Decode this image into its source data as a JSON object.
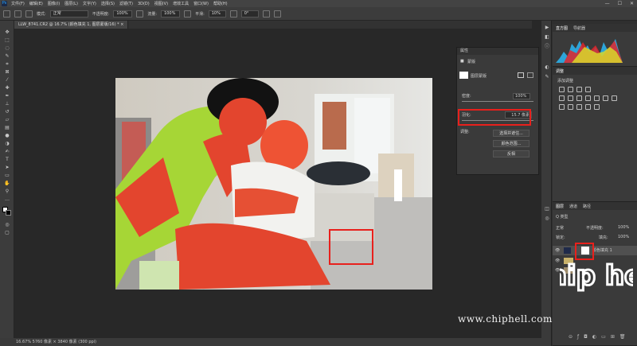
{
  "app_icon": "Ps",
  "menu": [
    "文件(F)",
    "编辑(E)",
    "图像(I)",
    "图层(L)",
    "文字(Y)",
    "选择(S)",
    "滤镜(T)",
    "3D(D)",
    "视图(V)",
    "增效工具",
    "窗口(W)",
    "帮助(H)"
  ],
  "window_controls": [
    "—",
    "☐",
    "✕"
  ],
  "options_bar": {
    "mode_label": "模式:",
    "mode_value": "正常",
    "opacity_label": "不透明度:",
    "opacity_value": "100%",
    "flow_label": "流量:",
    "flow_value": "100%",
    "smooth_label": "平滑:",
    "smooth_value": "10%",
    "angle_value": "0°"
  },
  "document_tab": "LLW_8741.CR2 @ 16.7% (颜色填充 1, 图层蒙版/16) * ×",
  "status_bar": "16.67%    5760 像素 × 3840 像素 (300 ppi)",
  "histogram_panel": {
    "tabs": [
      "直方图",
      "导航器"
    ]
  },
  "properties_panel": {
    "title": "属性",
    "section_label": "蒙版",
    "layer_mask_label": "图层蒙版",
    "density_label": "密度:",
    "density_value": "100%",
    "feather_label": "羽化:",
    "feather_value": "15.7 像素",
    "adjust_label": "调整:",
    "buttons": [
      "选择并遮住...",
      "颜色范围...",
      "反相"
    ]
  },
  "adjustments_panel": {
    "title": "调整",
    "subtitle": "添加调整"
  },
  "layers_panel": {
    "tabs": [
      "图层",
      "通道",
      "路径"
    ],
    "kind_label": "Q 类型",
    "blend_mode": "正常",
    "opacity_label": "不透明度:",
    "opacity_value": "100%",
    "lock_label": "锁定:",
    "fill_label": "填充:",
    "fill_value": "100%",
    "layers": [
      {
        "name": "颜色填充 1",
        "selected": true
      },
      {
        "name": "",
        "selected": false
      },
      {
        "name": "",
        "selected": false
      }
    ]
  },
  "watermark": {
    "logo_text": "chip hell",
    "site": "www.chiphell.com"
  },
  "colors": {
    "accent_red": "#e8201c",
    "panel_bg": "#3a3a3a",
    "canvas_bg": "#282828"
  }
}
